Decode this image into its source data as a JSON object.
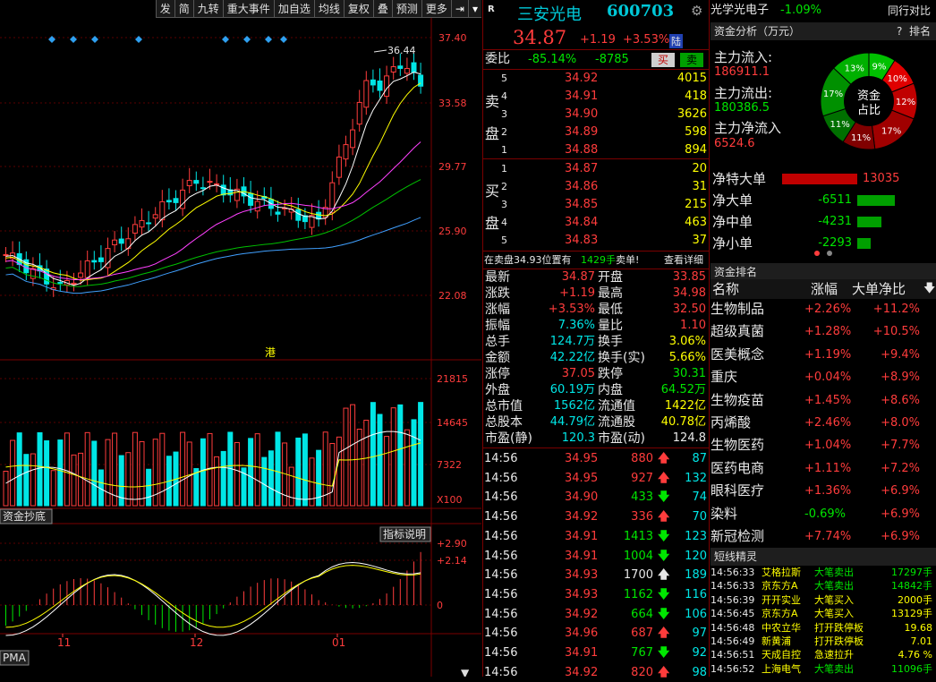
{
  "toolbar": [
    "发",
    "简",
    "九转",
    "重大事件",
    "加自选",
    "均线",
    "复权",
    "叠",
    "预测",
    "更多"
  ],
  "chart": {
    "price_ticks": [
      "37.40",
      "33.58",
      "29.77",
      "25.90",
      "22.08"
    ],
    "vol_ticks": [
      "21815",
      "14645",
      "7322",
      "X100"
    ],
    "ind_ticks": [
      "+2.90",
      "+2.14",
      "0"
    ],
    "high_label": "36.44",
    "month_labels": [
      "11",
      "12",
      "01"
    ],
    "hk_label": "港",
    "tab1": "资金抄底",
    "tab2": "指标说明",
    "tab3": "PMA"
  },
  "stock": {
    "badge": "R",
    "name": "三安光电",
    "code": "600703",
    "price": "34.87",
    "change": "+1.19",
    "pct": "+3.53%",
    "tag": "陆"
  },
  "ratio": {
    "label": "委比",
    "pct": "-85.14%",
    "diff": "-8785",
    "sell_btn": "买",
    "buy_btn": "卖"
  },
  "asks": [
    {
      "n": "5",
      "p": "34.92",
      "v": "4015"
    },
    {
      "n": "4",
      "p": "34.91",
      "v": "418"
    },
    {
      "n": "3",
      "p": "34.90",
      "v": "3626"
    },
    {
      "n": "2",
      "p": "34.89",
      "v": "598"
    },
    {
      "n": "1",
      "p": "34.88",
      "v": "894"
    }
  ],
  "bids": [
    {
      "n": "1",
      "p": "34.87",
      "v": "20"
    },
    {
      "n": "2",
      "p": "34.86",
      "v": "31"
    },
    {
      "n": "3",
      "p": "34.85",
      "v": "215"
    },
    {
      "n": "4",
      "p": "34.84",
      "v": "463"
    },
    {
      "n": "5",
      "p": "34.83",
      "v": "37"
    }
  ],
  "side": {
    "sell": [
      "卖",
      "盘"
    ],
    "buy": [
      "买",
      "盘"
    ]
  },
  "notice": {
    "a": "在卖盘34.93位置有",
    "b": "1429手",
    "c": "卖单!",
    "d": "查看详细"
  },
  "stats": [
    [
      "最新",
      "34.87",
      "开盘",
      "33.85"
    ],
    [
      "涨跌",
      "+1.19",
      "最高",
      "34.98"
    ],
    [
      "涨幅",
      "+3.53%",
      "最低",
      "32.50"
    ],
    [
      "振幅",
      "7.36%",
      "量比",
      "1.10"
    ],
    [
      "总手",
      "124.7万",
      "换手",
      "3.06%"
    ],
    [
      "金额",
      "42.22亿",
      "换手(实)",
      "5.66%"
    ],
    [
      "涨停",
      "37.05",
      "跌停",
      "30.31"
    ],
    [
      "外盘",
      "60.19万",
      "内盘",
      "64.52万"
    ],
    [
      "总市值",
      "1562亿",
      "流通值",
      "1422亿"
    ],
    [
      "总股本",
      "44.79亿",
      "流通股",
      "40.78亿"
    ],
    [
      "市盈(静)",
      "120.3",
      "市盈(动)",
      "124.8"
    ]
  ],
  "ticks": [
    {
      "t": "14:56",
      "p": "34.95",
      "v": "880",
      "d": "up",
      "n": "87"
    },
    {
      "t": "14:56",
      "p": "34.95",
      "v": "927",
      "d": "up",
      "n": "132"
    },
    {
      "t": "14:56",
      "p": "34.90",
      "v": "433",
      "d": "dn",
      "n": "74"
    },
    {
      "t": "14:56",
      "p": "34.92",
      "v": "336",
      "d": "up",
      "n": "70"
    },
    {
      "t": "14:56",
      "p": "34.91",
      "v": "1413",
      "d": "dn",
      "n": "123"
    },
    {
      "t": "14:56",
      "p": "34.91",
      "v": "1004",
      "d": "dn",
      "n": "120"
    },
    {
      "t": "14:56",
      "p": "34.93",
      "v": "1700",
      "d": "up",
      "n": "189"
    },
    {
      "t": "14:56",
      "p": "34.93",
      "v": "1162",
      "d": "dn",
      "n": "116"
    },
    {
      "t": "14:56",
      "p": "34.92",
      "v": "664",
      "d": "dn",
      "n": "106"
    },
    {
      "t": "14:56",
      "p": "34.96",
      "v": "687",
      "d": "up",
      "n": "97"
    },
    {
      "t": "14:56",
      "p": "34.91",
      "v": "767",
      "d": "dn",
      "n": "92"
    },
    {
      "t": "14:56",
      "p": "34.92",
      "v": "820",
      "d": "up",
      "n": "98"
    }
  ],
  "sector": {
    "name": "光学光电子",
    "pct": "-1.09%",
    "compare": "同行对比"
  },
  "fund": {
    "title": "资金分析（万元）",
    "help": "?",
    "rank": "排名",
    "in_label": "主力流入:",
    "in": "186911.1",
    "out_label": "主力流出:",
    "out": "180386.5",
    "net_label": "主力净流入",
    "net": "6524.6",
    "pie_center": [
      "资金",
      "占比"
    ],
    "pie": [
      "9%",
      "10%",
      "12%",
      "17%",
      "11%",
      "11%",
      "17%",
      "13%"
    ],
    "flows": [
      {
        "l": "净特大单",
        "v": "13035"
      },
      {
        "l": "净大单",
        "v": "-6511"
      },
      {
        "l": "净中单",
        "v": "-4231"
      },
      {
        "l": "净小单",
        "v": "-2293"
      }
    ]
  },
  "rank": {
    "title": "资金排名",
    "h1": "名称",
    "h2": "涨幅",
    "h3": "大单净比",
    "rows": [
      [
        "生物制品",
        "+2.26%",
        "+11.2%"
      ],
      [
        "超级真菌",
        "+1.28%",
        "+10.5%"
      ],
      [
        "医美概念",
        "+1.19%",
        "+9.4%"
      ],
      [
        "重庆",
        "+0.04%",
        "+8.9%"
      ],
      [
        "生物疫苗",
        "+1.45%",
        "+8.6%"
      ],
      [
        "丙烯酸",
        "+2.46%",
        "+8.0%"
      ],
      [
        "生物医药",
        "+1.04%",
        "+7.7%"
      ],
      [
        "医药电商",
        "+1.11%",
        "+7.2%"
      ],
      [
        "眼科医疗",
        "+1.36%",
        "+6.9%"
      ],
      [
        "染料",
        "-0.69%",
        "+6.9%"
      ],
      [
        "新冠检测",
        "+7.74%",
        "+6.9%"
      ]
    ]
  },
  "short": {
    "title": "短线精灵",
    "rows": [
      [
        "14:56:33",
        "艾格拉斯",
        "大笔卖出",
        "17297手"
      ],
      [
        "14:56:33",
        "京东方A",
        "大笔卖出",
        "14842手"
      ],
      [
        "14:56:39",
        "开开实业",
        "大笔买入",
        "2000手"
      ],
      [
        "14:56:45",
        "京东方A",
        "大笔买入",
        "13129手"
      ],
      [
        "14:56:48",
        "中农立华",
        "打开跌停板",
        "19.68"
      ],
      [
        "14:56:49",
        "新黄浦",
        "打开跌停板",
        "7.01"
      ],
      [
        "14:56:51",
        "天成自控",
        "急速拉升",
        "4.76 %"
      ],
      [
        "14:56:52",
        "上海电气",
        "大笔卖出",
        "11096手"
      ]
    ]
  },
  "colors": {
    "up": "#ff3c3c",
    "down": "#00e600",
    "bg": "#000000"
  }
}
